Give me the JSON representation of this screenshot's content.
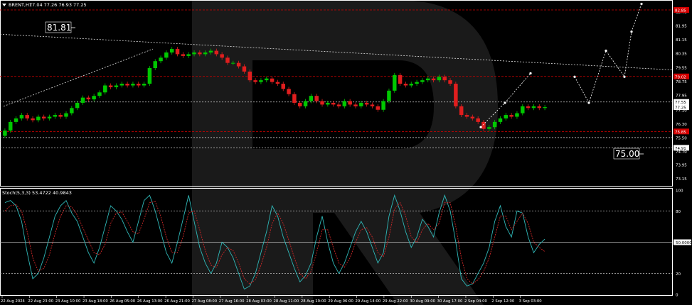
{
  "header": {
    "symbol": "BRENT,H1",
    "ohlc": "77.04 77.26 76.93 77.25",
    "indicator": "Stoch(5,3,3) 53.4722 40.9843"
  },
  "annotations": {
    "upper_level": "81.81",
    "lower_level": "75.00"
  },
  "colors": {
    "background": "#000000",
    "bull": "#00c800",
    "bear": "#e01e1e",
    "grid": "#ffffff",
    "resistance_line": "#d40000",
    "stoch_main": "#2fb7b7",
    "stoch_signal": "#d02828",
    "watermark": "#1a1a1a"
  },
  "chart_data": [
    {
      "type": "candlestick",
      "title": "BRENT,H1",
      "ylim": [
        72.8,
        83.3
      ],
      "price_ticks": [
        73.15,
        73.95,
        74.7,
        75.5,
        76.3,
        77.1,
        77.95,
        78.75,
        79.55,
        80.35,
        81.15,
        81.95,
        82.75
      ],
      "highlight_prices": [
        {
          "value": "82.85",
          "color": "#d40000"
        },
        {
          "value": "79.02",
          "color": "#d40000"
        },
        {
          "value": "77.55",
          "color": "#000000"
        },
        {
          "value": "77.25",
          "color": "#000000"
        },
        {
          "value": "75.85",
          "color": "#d40000"
        },
        {
          "value": "74.91",
          "color": "#000000"
        }
      ],
      "horizontal_levels": [
        {
          "price": 82.85,
          "style": "dash-red"
        },
        {
          "price": 79.02,
          "style": "dash-red"
        },
        {
          "price": 77.55,
          "style": "dash-white"
        },
        {
          "price": 75.85,
          "style": "dash-red"
        },
        {
          "price": 75.5,
          "style": "dash-white"
        },
        {
          "price": 74.91,
          "style": "dash-white"
        }
      ],
      "x_labels": [
        "22 Aug 2024",
        "22 Aug 23:00",
        "23 Aug 10:00",
        "23 Aug 18:00",
        "26 Aug 05:00",
        "26 Aug 13:00",
        "26 Aug 21:00",
        "27 Aug 08:00",
        "27 Aug 16:00",
        "28 Aug 03:00",
        "28 Aug 11:00",
        "28 Aug 19:00",
        "29 Aug 06:00",
        "29 Aug 14:00",
        "29 Aug 22:00",
        "30 Aug 09:00",
        "30 Aug 17:00",
        "2 Sep 04:00",
        "2 Sep 12:00",
        "3 Sep 03:00"
      ],
      "close": [
        75.9,
        76.4,
        76.6,
        76.8,
        76.6,
        76.5,
        76.7,
        76.6,
        76.7,
        76.8,
        76.7,
        76.9,
        77.2,
        77.5,
        77.8,
        77.7,
        77.9,
        78.1,
        78.5,
        78.4,
        78.5,
        78.6,
        78.5,
        78.6,
        78.5,
        78.6,
        79.5,
        79.9,
        80.1,
        80.4,
        80.6,
        80.3,
        80.2,
        80.3,
        80.4,
        80.3,
        80.4,
        80.5,
        80.3,
        80.1,
        79.8,
        79.8,
        79.6,
        79.3,
        78.8,
        78.7,
        78.8,
        78.9,
        78.7,
        78.6,
        78.3,
        78.0,
        77.5,
        77.3,
        77.6,
        77.9,
        77.6,
        77.4,
        77.5,
        77.4,
        77.3,
        77.6,
        77.4,
        77.3,
        77.5,
        77.4,
        77.3,
        77.1,
        77.6,
        78.2,
        79.1,
        78.6,
        78.5,
        78.6,
        78.7,
        78.8,
        78.9,
        78.8,
        79.0,
        78.8,
        78.6,
        77.3,
        76.8,
        76.7,
        76.6,
        76.4,
        76.0,
        76.1,
        76.4,
        76.6,
        76.8,
        76.7,
        76.9,
        77.3,
        77.2,
        77.3,
        77.2,
        77.25
      ],
      "volatility_note": "",
      "forecast": {
        "path_a": [
          76.1,
          77.5,
          79.2
        ],
        "path_b": [
          79.0,
          77.5,
          80.5,
          79.0,
          81.6,
          83.2
        ]
      }
    },
    {
      "type": "line",
      "title": "Stoch(5,3,3) 53.4722 40.9843",
      "ylim": [
        0,
        100
      ],
      "levels": [
        80,
        50,
        20
      ],
      "axis_ticks": [
        "100",
        "80",
        "50.0000",
        "20",
        "0"
      ],
      "series": [
        {
          "name": "main",
          "values": [
            88,
            90,
            85,
            70,
            40,
            15,
            20,
            35,
            55,
            75,
            85,
            90,
            78,
            70,
            55,
            40,
            30,
            45,
            65,
            85,
            80,
            72,
            60,
            50,
            70,
            90,
            95,
            80,
            60,
            40,
            30,
            50,
            72,
            95,
            70,
            45,
            30,
            20,
            30,
            50,
            45,
            35,
            20,
            5,
            8,
            20,
            40,
            60,
            85,
            75,
            55,
            40,
            25,
            12,
            18,
            30,
            55,
            75,
            50,
            30,
            20,
            30,
            45,
            60,
            70,
            60,
            45,
            30,
            40,
            75,
            95,
            80,
            60,
            45,
            55,
            72,
            65,
            55,
            78,
            95,
            80,
            50,
            15,
            8,
            10,
            20,
            30,
            45,
            70,
            85,
            65,
            55,
            80,
            78,
            55,
            40,
            48,
            53
          ]
        },
        {
          "name": "signal",
          "values": [
            80,
            85,
            86,
            80,
            60,
            35,
            22,
            25,
            38,
            58,
            75,
            85,
            84,
            76,
            64,
            52,
            40,
            38,
            48,
            68,
            78,
            79,
            70,
            60,
            58,
            72,
            88,
            89,
            75,
            55,
            40,
            40,
            55,
            78,
            80,
            62,
            42,
            28,
            26,
            38,
            45,
            42,
            30,
            15,
            10,
            14,
            28,
            45,
            68,
            78,
            68,
            52,
            35,
            20,
            15,
            22,
            40,
            62,
            62,
            45,
            30,
            26,
            35,
            50,
            62,
            64,
            55,
            40,
            36,
            55,
            82,
            88,
            75,
            55,
            50,
            62,
            68,
            62,
            68,
            88,
            88,
            65,
            35,
            15,
            10,
            14,
            22,
            35,
            55,
            75,
            75,
            62,
            70,
            78,
            68,
            50,
            45,
            41
          ]
        }
      ]
    }
  ]
}
